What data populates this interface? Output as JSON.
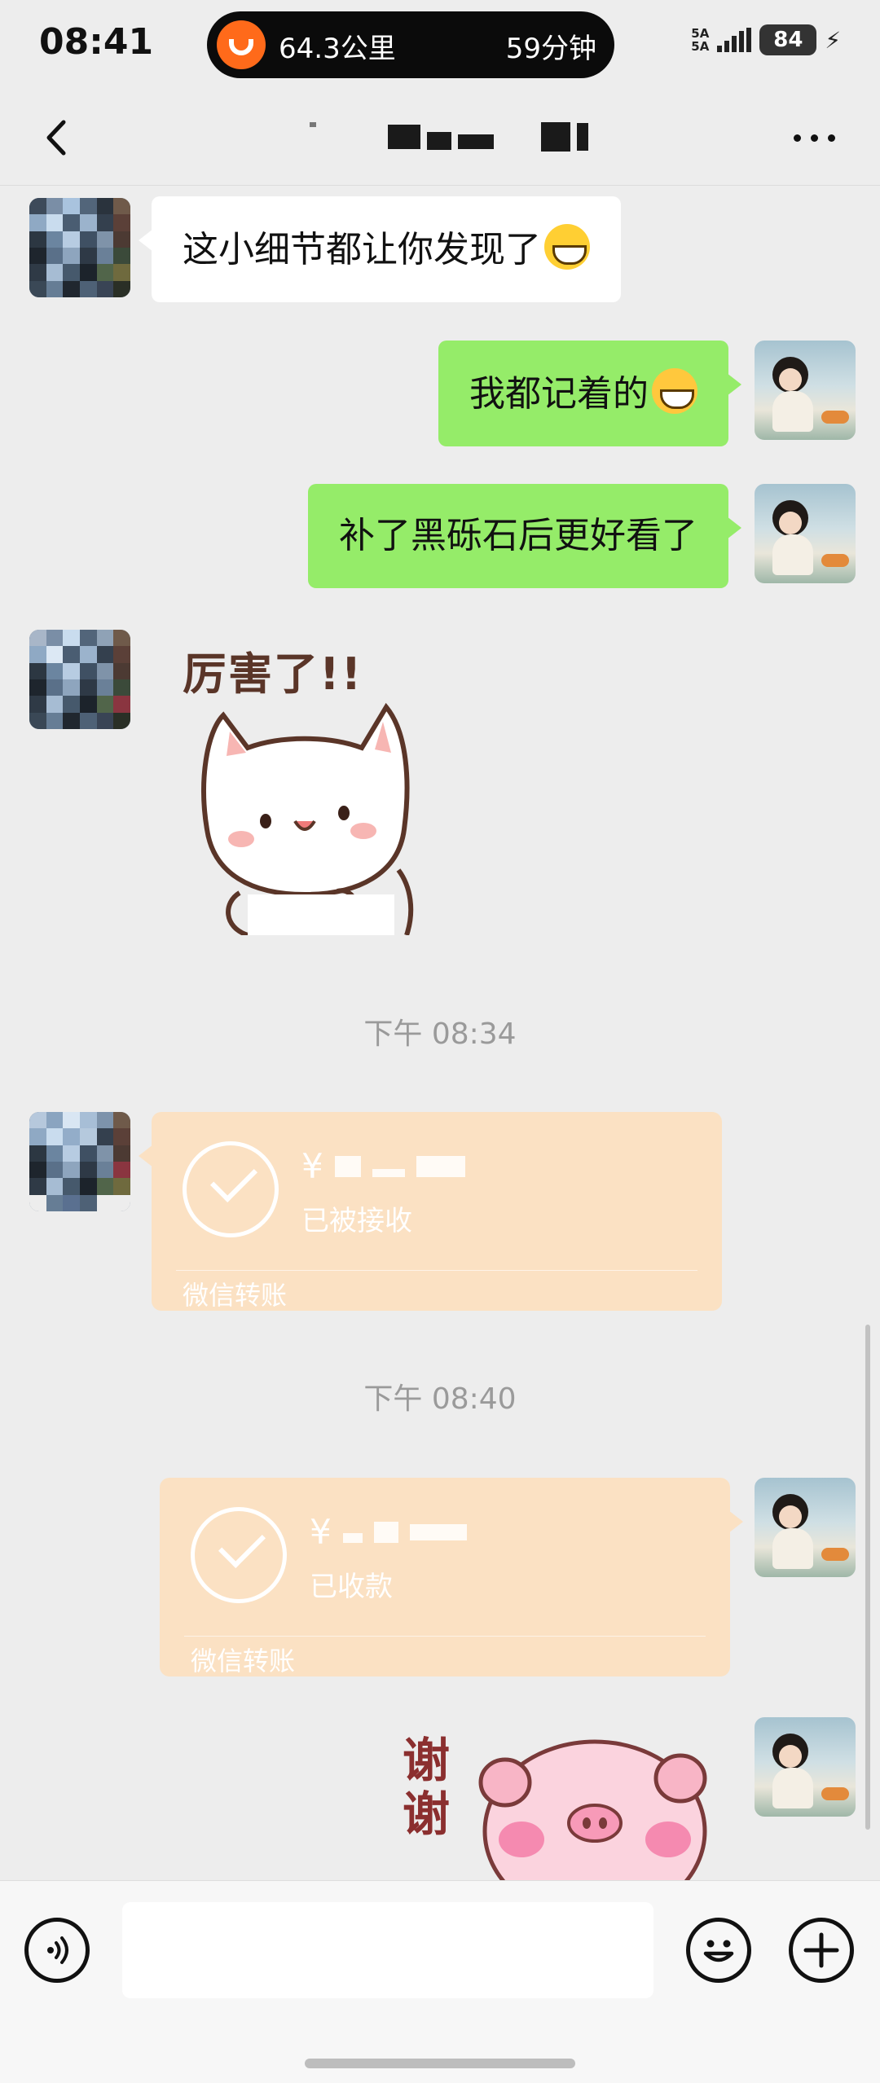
{
  "status_bar": {
    "time": "08:41",
    "trip_distance": "64.3公里",
    "trip_time": "59分钟",
    "network_top": "5A",
    "network_bottom": "5A",
    "battery": "84"
  },
  "nav": {
    "title_redacted": true
  },
  "messages": [
    {
      "id": "m1",
      "side": "left",
      "type": "text",
      "text": "这小细节都让你发现了",
      "emoji": "grinning-emoji"
    },
    {
      "id": "m2",
      "side": "right",
      "type": "text",
      "text": "我都记着的",
      "emoji": "laughing-tears-emoji"
    },
    {
      "id": "m3",
      "side": "right",
      "type": "text",
      "text": "补了黑砾石后更好看了"
    },
    {
      "id": "m4",
      "side": "left",
      "type": "sticker",
      "caption": "厉害了!!",
      "sticker": "white-cat-sticker"
    },
    {
      "id": "t1",
      "type": "timestamp",
      "text": "下午 08:34"
    },
    {
      "id": "m5",
      "side": "left",
      "type": "transfer",
      "currency": "¥",
      "status": "已被接收",
      "label": "微信转账"
    },
    {
      "id": "t2",
      "type": "timestamp",
      "text": "下午 08:40"
    },
    {
      "id": "m6",
      "side": "right",
      "type": "transfer",
      "currency": "¥",
      "status": "已收款",
      "label": "微信转账"
    },
    {
      "id": "m7",
      "side": "right",
      "type": "sticker",
      "caption": "谢谢",
      "sticker": "pink-pig-sticker"
    }
  ],
  "colors": {
    "background": "#ededed",
    "bubble_self": "#95ec69",
    "bubble_other": "#ffffff",
    "transfer_card": "#fbe1c3",
    "didi_orange": "#ff6a1a"
  },
  "input_bar": {
    "voice_icon": "voice-icon",
    "emoji_icon": "emoji-icon",
    "plus_icon": "plus-icon",
    "text_value": ""
  }
}
